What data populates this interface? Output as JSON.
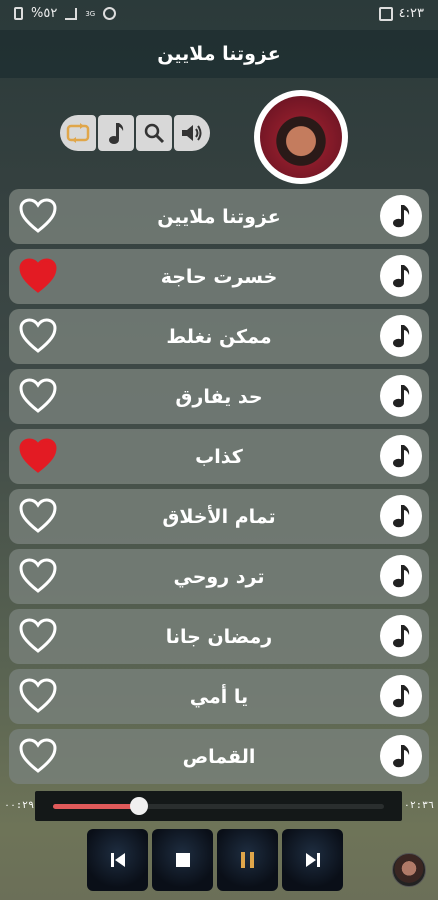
{
  "status_bar": {
    "time": "٤:٢٣",
    "battery": "%٥٢",
    "network": "3G"
  },
  "header": {
    "title": "عزوتنا ملايين"
  },
  "controls": [
    {
      "name": "repeat-icon",
      "active": true
    },
    {
      "name": "music-note-icon",
      "active": false
    },
    {
      "name": "search-icon",
      "active": false
    },
    {
      "name": "volume-icon",
      "active": false
    }
  ],
  "songs": [
    {
      "title": "عزوتنا ملايين",
      "favorite": false
    },
    {
      "title": "خسرت حاجة",
      "favorite": true
    },
    {
      "title": "ممكن نغلط",
      "favorite": false
    },
    {
      "title": "حد يفارق",
      "favorite": false
    },
    {
      "title": "كذاب",
      "favorite": true
    },
    {
      "title": "تمام الأخلاق",
      "favorite": false
    },
    {
      "title": "ترد روحي",
      "favorite": false
    },
    {
      "title": "رمضان جانا",
      "favorite": false
    },
    {
      "title": "يا أمي",
      "favorite": false
    },
    {
      "title": "القماص",
      "favorite": false
    }
  ],
  "player": {
    "elapsed": "٠٠:٢٩",
    "duration": "٠٢:٣٦",
    "progress": 0.26
  },
  "colors": {
    "accent": "#e05a5a",
    "heart_on": "#e31b23",
    "repeat_active": "#e0a64a"
  }
}
